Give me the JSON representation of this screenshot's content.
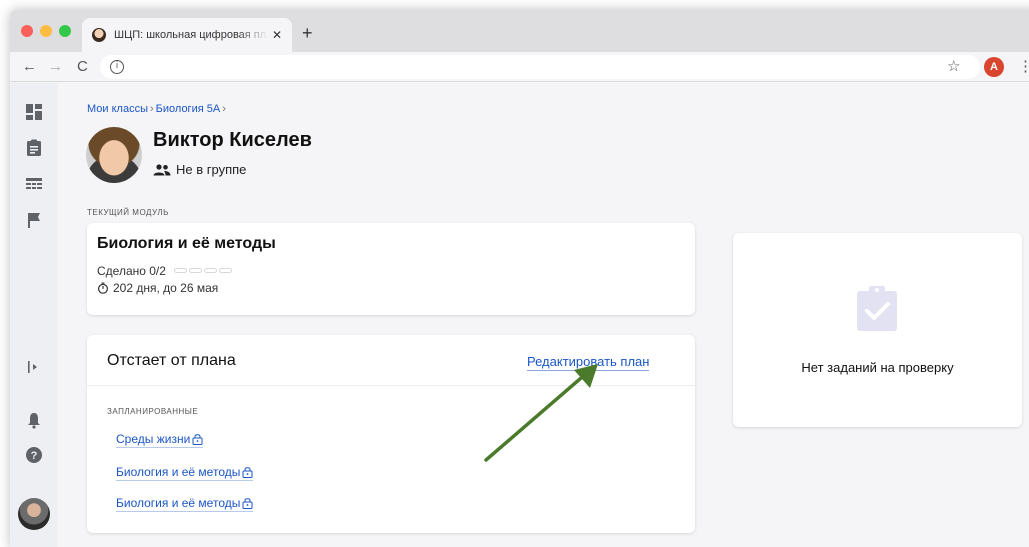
{
  "browser": {
    "tab_title": "ШЦП: школьная цифровая платформа",
    "tab_close": "✕",
    "new_tab": "+",
    "back": "←",
    "forward": "→",
    "reload": "C",
    "info": "i",
    "star": "☆",
    "profile_initial": "A",
    "menu": "⋮"
  },
  "breadcrumb": {
    "items": [
      "Мои классы",
      "Биология 5А"
    ],
    "separator": "›"
  },
  "student": {
    "name": "Виктор Киселев",
    "group": "Не в группе"
  },
  "current_module": {
    "label": "текущий модуль",
    "title": "Биология и её методы",
    "done": "Сделано 0/2",
    "progress_fraction": 0,
    "deadline": "202 дня, до 26 мая"
  },
  "plan": {
    "title": "Отстает от плана",
    "edit_link": "Редактировать план",
    "planned_label": "запланированные",
    "items": [
      {
        "label": "Среды жизни"
      },
      {
        "label": "Биология и её методы"
      },
      {
        "label": "Биология и её методы"
      }
    ]
  },
  "review": {
    "empty_text": "Нет заданий на проверку"
  },
  "colors": {
    "link": "#1a56c4",
    "arrow": "#4a7a2a",
    "review_icon": "#e3e2f2"
  }
}
